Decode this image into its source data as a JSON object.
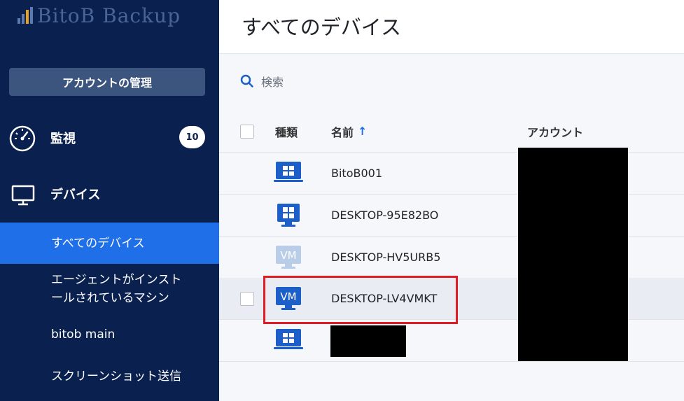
{
  "app": {
    "logo_text": "BitoB Backup"
  },
  "sidebar": {
    "account_button": "アカウントの管理",
    "monitor": {
      "label": "監視",
      "badge": "10",
      "icon": "dashboard-gauge-icon"
    },
    "devices": {
      "label": "デバイス",
      "icon": "monitor-icon"
    },
    "sub_items": [
      {
        "label": "すべてのデバイス",
        "active": true
      },
      {
        "label": "エージェントがインストールされているマシン",
        "line1": "エージェントがインスト",
        "line2": "ールされているマシン",
        "active": false
      },
      {
        "label": "bitob main",
        "active": false
      },
      {
        "label": "スクリーンショット送信",
        "active": false
      }
    ]
  },
  "main": {
    "title": "すべてのデバイス",
    "search_placeholder": "検索",
    "columns": {
      "type": "種類",
      "name": "名前",
      "name_sort": "↑",
      "account": "アカウント"
    },
    "rows": [
      {
        "type": "windows-device-icon",
        "name": "BitoB001",
        "selected": false
      },
      {
        "type": "windows-device-icon",
        "name": "DESKTOP-95E82BO",
        "selected": false
      },
      {
        "type": "vm-icon-light",
        "name": "DESKTOP-HV5URB5",
        "selected": false
      },
      {
        "type": "vm-icon",
        "name": "DESKTOP-LV4VMKT",
        "selected": false,
        "highlighted": true
      },
      {
        "type": "windows-device-icon",
        "name": "",
        "selected": false
      }
    ],
    "colors": {
      "accent": "#1f6fe8",
      "sidebar_bg": "#0a2150",
      "icon_blue": "#1d5fc9",
      "highlight_border": "#e01c24"
    }
  }
}
